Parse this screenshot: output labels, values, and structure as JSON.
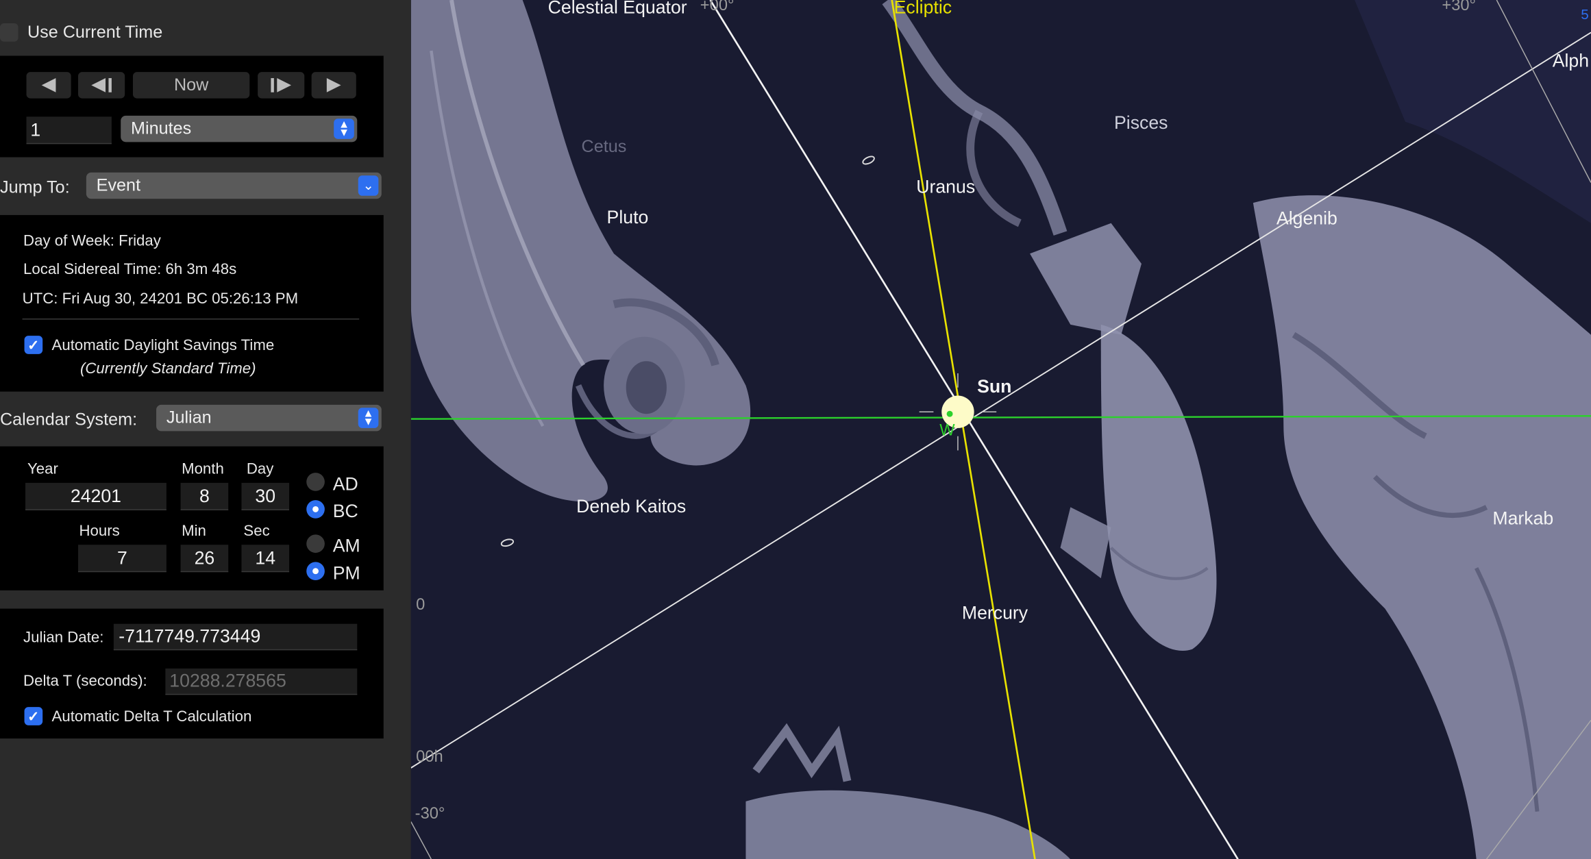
{
  "time_panel": {
    "use_current_time_label": "Use Current Time",
    "now_label": "Now",
    "step_value": "1",
    "step_unit": "Minutes",
    "jump_to_label": "Jump To:",
    "jump_to_value": "Event"
  },
  "info": {
    "day_of_week": "Day of Week:  Friday",
    "sidereal_time": "Local Sidereal Time:  6h 3m 48s",
    "utc": "UTC:  Fri Aug 30, 24201 BC 05:26:13 PM",
    "auto_dst_label": "Automatic Daylight Savings Time",
    "dst_status": "(Currently Standard Time)"
  },
  "calendar": {
    "label": "Calendar System:",
    "value": "Julian"
  },
  "date_fields": {
    "year_label": "Year",
    "month_label": "Month",
    "day_label": "Day",
    "year": "24201",
    "month": "8",
    "day": "30",
    "ad_label": "AD",
    "bc_label": "BC",
    "hours_label": "Hours",
    "min_label": "Min",
    "sec_label": "Sec",
    "hours": "7",
    "min": "26",
    "sec": "14",
    "am_label": "AM",
    "pm_label": "PM"
  },
  "julian": {
    "jd_label": "Julian Date:",
    "jd_value": "-7117749.773449",
    "delta_label": "Delta T (seconds):",
    "delta_value": "10288.278565",
    "auto_delta_label": "Automatic Delta T Calculation"
  },
  "sky": {
    "celestial_equator": "Celestial Equator",
    "ra_00": "+00°",
    "ecliptic": "Ecliptic",
    "dec_plus30": "+30°",
    "alpheratz": "Alph",
    "pisces": "Pisces",
    "cetus": "Cetus",
    "uranus": "Uranus",
    "pluto": "Pluto",
    "algenib": "Algenib",
    "sun": "Sun",
    "horizon_w": "W",
    "deneb_kaitos": "Deneb Kaitos",
    "markab": "Markab",
    "mercury": "Mercury",
    "zero": "0",
    "ra_00h": "00h",
    "dec_minus30": "-30°",
    "edge_5": "5"
  },
  "colors": {
    "accent": "#2d6ff0",
    "ecliptic": "#e8e200",
    "horizon": "#2cd12c",
    "sky": "#191b31",
    "figure": "#8a8ca8"
  }
}
